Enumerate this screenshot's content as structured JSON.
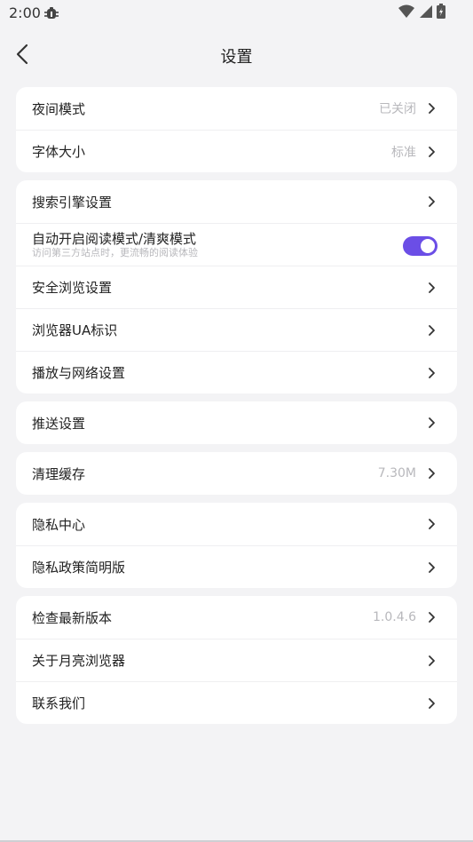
{
  "status_bar": {
    "time": "2:00"
  },
  "header": {
    "title": "设置"
  },
  "colors": {
    "accent": "#6b4ee6",
    "background": "#f3f3f5",
    "value_text": "#b8b8bc"
  },
  "groups": [
    {
      "items": [
        {
          "label": "夜间模式",
          "value": "已关闭"
        },
        {
          "label": "字体大小",
          "value": "标准"
        }
      ]
    },
    {
      "items": [
        {
          "label": "搜索引擎设置"
        },
        {
          "label": "自动开启阅读模式/清爽模式",
          "sublabel": "访问第三方站点时，更流畅的阅读体验",
          "toggle_on": true
        },
        {
          "label": "安全浏览设置"
        },
        {
          "label": "浏览器UA标识"
        },
        {
          "label": "播放与网络设置"
        }
      ]
    },
    {
      "items": [
        {
          "label": "推送设置"
        }
      ]
    },
    {
      "items": [
        {
          "label": "清理缓存",
          "value": "7.30M"
        }
      ]
    },
    {
      "items": [
        {
          "label": "隐私中心"
        },
        {
          "label": "隐私政策简明版"
        }
      ]
    },
    {
      "items": [
        {
          "label": "检查最新版本",
          "value": "1.0.4.6"
        },
        {
          "label": "关于月亮浏览器"
        },
        {
          "label": "联系我们"
        }
      ]
    }
  ]
}
